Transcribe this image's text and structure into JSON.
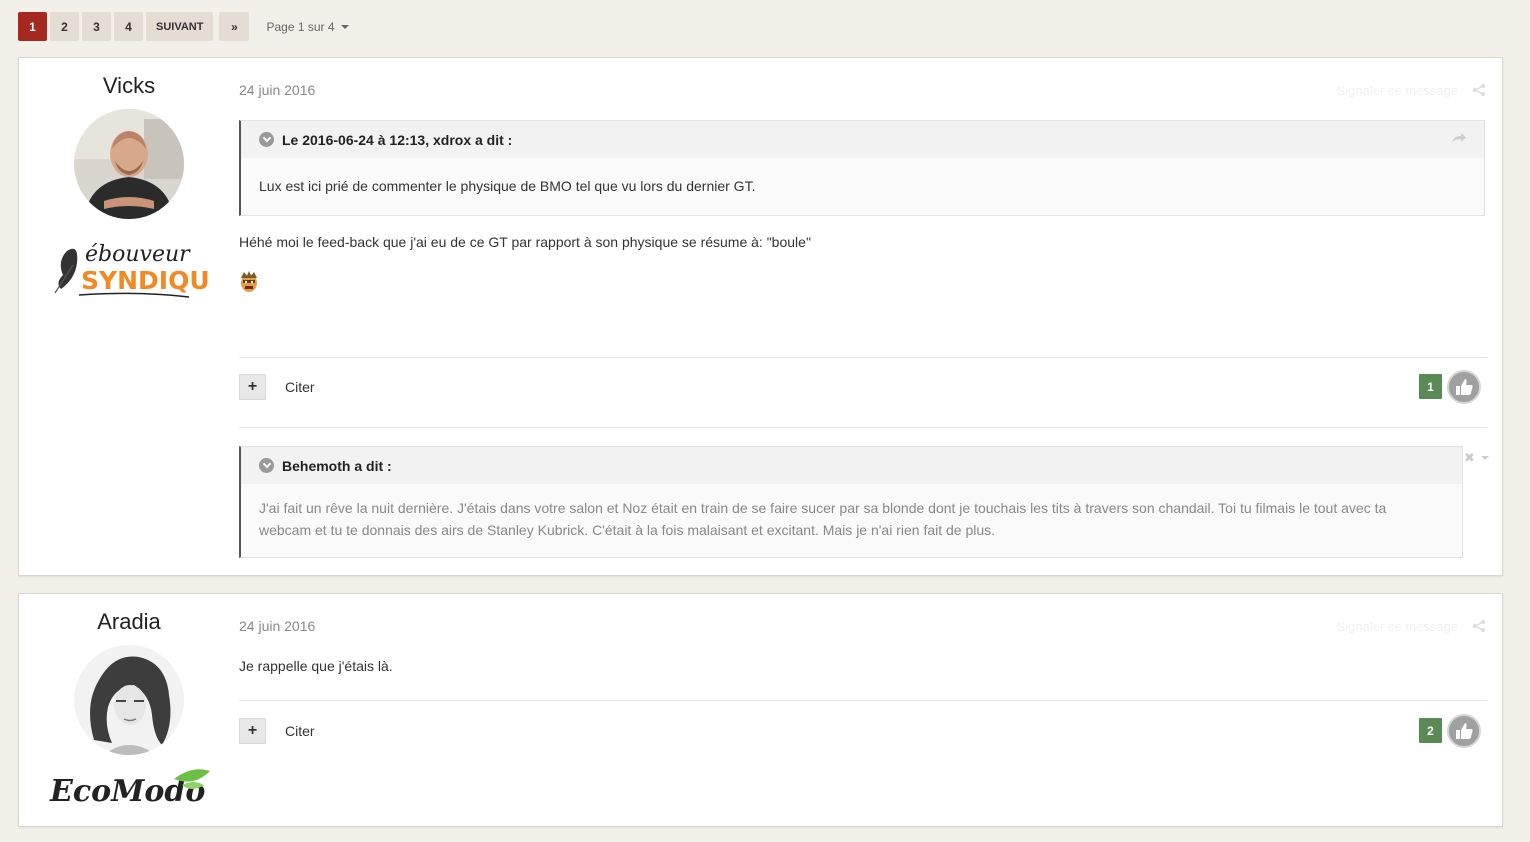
{
  "pagination": {
    "pages": [
      "1",
      "2",
      "3",
      "4"
    ],
    "active_page": "1",
    "next_label": "SUIVANT",
    "last_label": "»",
    "page_info": "Page 1 sur 4"
  },
  "posts": [
    {
      "author": "Vicks",
      "date": "24 juin 2016",
      "report_label": "Signaler ce message",
      "quote1": {
        "header": "Le 2016-06-24 à 12:13, xdrox a dit :",
        "body": "Lux est ici prié de commenter le physique de BMO tel que vu lors du dernier GT."
      },
      "text": "Héhé moi le feed-back que j'ai eu de ce GT par rapport à son physique se résume à: \"boule\"",
      "cite_label": "Citer",
      "reputation": "1",
      "quote2": {
        "header": "Behemoth a dit :",
        "body_line1": "J'ai fait un rêve la nuit dernière. J'étais dans votre salon et Noz était en train de se faire sucer par sa blonde dont je touchais les tits à travers son chandail. Toi tu filmais le tout avec ta",
        "body_line2": "webcam et tu te donnais des airs de Stanley Kubrick. C'était à la fois malaisant et excitant. Mais je n'ai rien fait de plus."
      },
      "badge": {
        "line1": "ébouveur",
        "line2": "SYNDIQUÉ"
      }
    },
    {
      "author": "Aradia",
      "date": "24 juin 2016",
      "report_label": "Signaler ce message",
      "text": "Je rappelle que j'étais là.",
      "cite_label": "Citer",
      "reputation": "2",
      "badge": {
        "line1": "EcoModo"
      }
    }
  ],
  "colors": {
    "page_bg": "#f3f0e9",
    "active_page": "#a7281e",
    "reputation_green": "#5a8a55",
    "badge_orange": "#f08a24",
    "leaf_green": "#6bbf45"
  }
}
